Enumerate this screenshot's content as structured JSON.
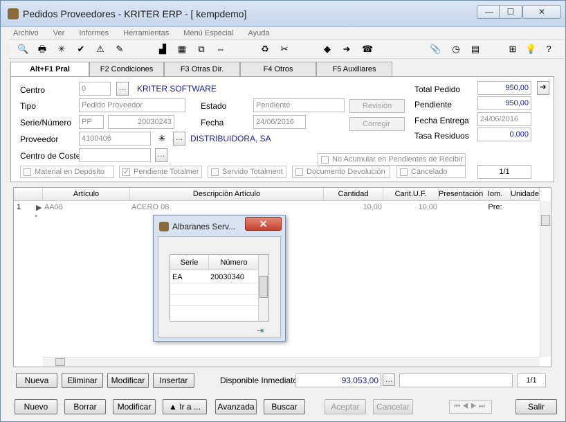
{
  "window": {
    "title": "Pedidos Proveedores - KRITER ERP - [ kempdemo]",
    "controls": [
      "minimize",
      "maximize",
      "close"
    ]
  },
  "menu": [
    "Archivo",
    "Ver",
    "Informes",
    "Herramientas",
    "Menú Especial",
    "Ayuda"
  ],
  "tabs": [
    "Alt+F1 Pral",
    "F2 Condiciones",
    "F3 Otras Dir.",
    "F4 Otros",
    "F5 Auxiliares"
  ],
  "form": {
    "centro_label": "Centro",
    "centro_value": "0",
    "centro_name": "KRITER SOFTWARE",
    "tipo_label": "Tipo",
    "tipo_value": "Pedido Proveedor",
    "estado_label": "Estado",
    "estado_value": "Pendiente",
    "serie_label": "Serie/Número",
    "serie_value": "PP",
    "numero_value": "20030243",
    "fecha_label": "Fecha",
    "fecha_value": "24/06/2016",
    "proveedor_label": "Proveedor",
    "proveedor_value": "4100406",
    "proveedor_name": "DISTRIBUIDORA, SA",
    "centro_coste_label": "Centro de Coste",
    "centro_coste_value": "",
    "revision_label": "Revisión",
    "corregir_label": "Corregir",
    "total_pedido_label": "Total Pedido",
    "total_pedido_value": "950,00",
    "pendiente_label": "Pendiente",
    "pendiente_value": "950,00",
    "fecha_entrega_label": "Fecha Entrega",
    "fecha_entrega_value": "24/06/2016",
    "tasa_residuos_label": "Tasa Residuos",
    "tasa_residuos_value": "0,000",
    "no_acumular_label": "No Acumular en Pendientes de Recibir",
    "material_deposito_label": "Material en Depósito",
    "pendiente_totalmer_label": "Pendiente Totalmer",
    "servido_total_label": "Servido Totalment",
    "documento_devolucion_label": "Documento Devolución",
    "cancelado_label": "Cancelado",
    "pager": "1/1"
  },
  "grid": {
    "headers": [
      "Artículo",
      "Descripción Artículo",
      "Cantidad",
      "Cant.U.F.",
      "Presentación",
      "Iom. Pre:",
      "Unidade"
    ],
    "rows": [
      {
        "num": "1",
        "articulo": "AA08",
        "descripcion": "ACERO 08",
        "cantidad": "10,00",
        "cant_uf": "10,00"
      }
    ],
    "new_row_marker": "*"
  },
  "grid_buttons": {
    "nueva": "Nueva",
    "eliminar": "Eliminar",
    "modificar": "Modificar",
    "insertar": "Insertar"
  },
  "disponible": {
    "label": "Disponible Inmediato",
    "value": "93.053,00",
    "pager": "1/1"
  },
  "bottom_buttons": {
    "nuevo": "Nuevo",
    "borrar": "Borrar",
    "modificar": "Modificar",
    "ir_a": "Ir a ...",
    "avanzada": "Avanzada",
    "buscar": "Buscar",
    "aceptar": "Aceptar",
    "cancelar": "Cancelar",
    "salir": "Salir"
  },
  "dialog": {
    "title": "Albaranes Serv...",
    "headers": [
      "Serie",
      "Número"
    ],
    "rows": [
      {
        "serie": "EA",
        "numero": "20030340"
      }
    ]
  },
  "colors": {
    "link_blue": "#1a1aa0",
    "window_bg": "#f0f0f0",
    "title_bg": "#c6d7ec",
    "close_red": "#c6412c"
  }
}
